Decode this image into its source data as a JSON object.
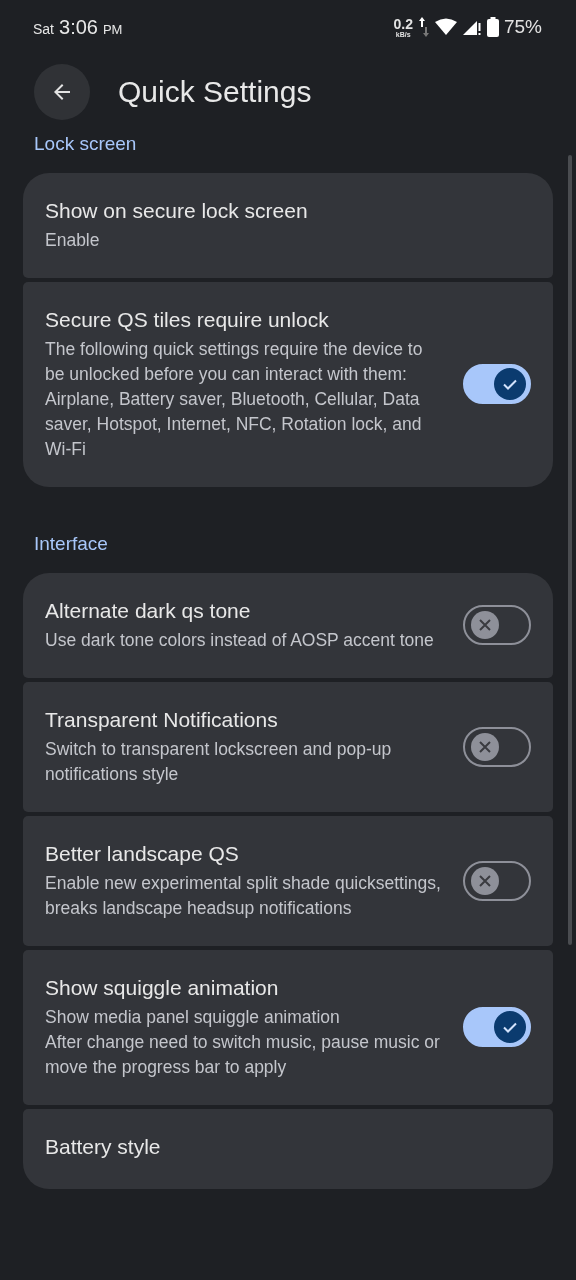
{
  "status_bar": {
    "day": "Sat",
    "time": "3:06",
    "ampm": "PM",
    "net_speed": "0.2",
    "net_unit": "kB/s",
    "battery": "75%"
  },
  "header": {
    "title": "Quick Settings"
  },
  "sections": [
    {
      "title": "Lock screen",
      "items": [
        {
          "kind": "plain",
          "title": "Show on secure lock screen",
          "summary": "Enable"
        },
        {
          "kind": "switch",
          "title": "Secure QS tiles require unlock",
          "summary": "The following quick settings require the device to be unlocked before you can interact with them:\nAirplane, Battery saver, Bluetooth, Cellular, Data saver, Hotspot, Internet, NFC, Rotation lock, and Wi-Fi",
          "on": true
        }
      ]
    },
    {
      "title": "Interface",
      "items": [
        {
          "kind": "switch",
          "title": "Alternate dark qs tone",
          "summary": "Use dark tone colors instead of AOSP accent tone",
          "on": false
        },
        {
          "kind": "switch",
          "title": "Transparent Notifications",
          "summary": "Switch to transparent lockscreen and pop-up notifications style",
          "on": false
        },
        {
          "kind": "switch",
          "title": "Better landscape QS",
          "summary": "Enable new experimental split shade quicksettings,\nbreaks landscape headsup notifications",
          "on": false
        },
        {
          "kind": "switch",
          "title": "Show squiggle animation",
          "summary": "Show media panel squiggle animation\nAfter change need to switch music, pause music or move the progress bar to apply",
          "on": true
        },
        {
          "kind": "plain",
          "title": "Battery style"
        }
      ]
    }
  ]
}
